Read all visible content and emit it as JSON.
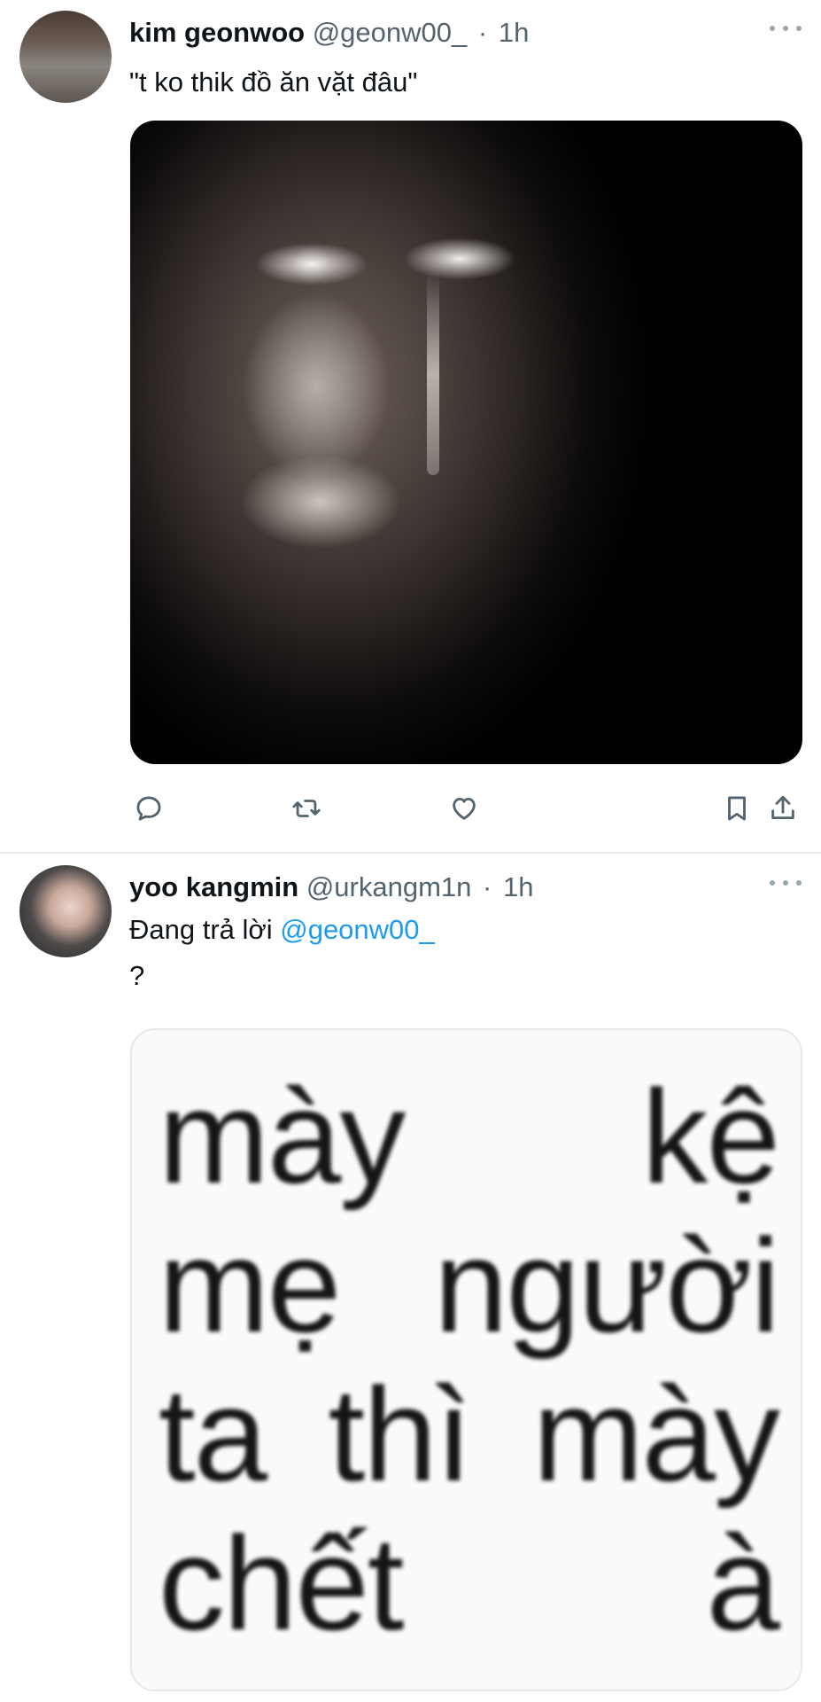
{
  "tweets": [
    {
      "name": "kim geonwoo",
      "handle": "@geonw00_",
      "dot": "·",
      "time": "1h",
      "text": "\"t ko thik đồ ăn vặt đâu\"",
      "media": "crying-face-image"
    },
    {
      "name": "yoo kangmin",
      "handle": "@urkangm1n",
      "dot": "·",
      "time": "1h",
      "replying_prefix": "Đang trả lời ",
      "replying_to": "@geonw00_",
      "text": "?",
      "meme_lines": [
        [
          "mày",
          "kệ"
        ],
        [
          "mẹ",
          "người"
        ],
        [
          "ta",
          "thì",
          "mày"
        ],
        [
          "chết",
          "à"
        ]
      ]
    }
  ],
  "icons": {
    "reply": "reply-icon",
    "retweet": "retweet-icon",
    "like": "heart-icon",
    "bookmark": "bookmark-icon",
    "share": "share-icon",
    "more": "more-icon"
  },
  "colors": {
    "text": "#0f1419",
    "secondary": "#536471",
    "accent": "#1d9bf0"
  }
}
